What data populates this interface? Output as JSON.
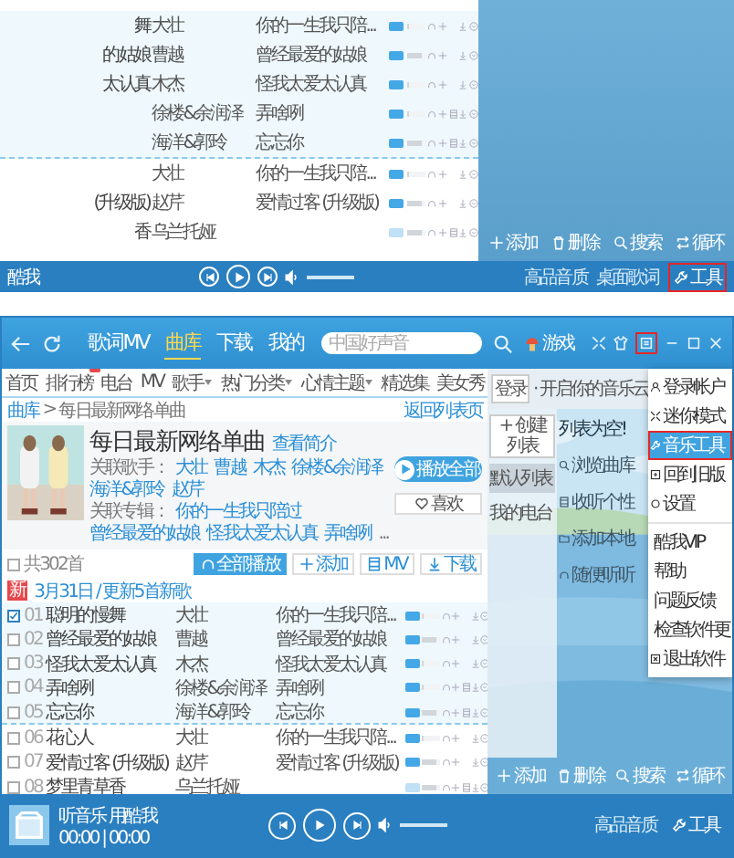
{
  "top_panel": {
    "rows": [
      {
        "title": "舞",
        "artist": "大壮",
        "album": "你的一生我只陪...",
        "hq": true,
        "level": 0.1,
        "mv": false,
        "new": true
      },
      {
        "title": "的姑娘",
        "artist": "曹越",
        "album": "曾经最爱的姑娘",
        "hq": true,
        "level": 0.8,
        "mv": false,
        "new": true
      },
      {
        "title": "太认真",
        "artist": "木杰",
        "album": "怪我太爱太认真",
        "hq": true,
        "level": 0.1,
        "mv": false,
        "new": true
      },
      {
        "artist": "徐楼&余润泽",
        "album": "弄啥咧",
        "hq": true,
        "level": 0.1,
        "mv": true,
        "new": true
      },
      {
        "artist": "海洋&郭玲",
        "album": "忘忘你",
        "hq": true,
        "level": 0.8,
        "mv": true,
        "new": true
      },
      {
        "artist": "大壮",
        "album": "你的一生我只陪...",
        "hq": true,
        "level": 0.1,
        "mv": false,
        "new": false
      },
      {
        "title": "(升级版)",
        "artist": "赵芹",
        "album": "爱情过客 (升级版)",
        "hq": true,
        "level": 0.8,
        "mv": false,
        "new": false
      },
      {
        "title": "香",
        "artist": "乌兰托娅",
        "hq": false,
        "level": 0.8,
        "mv": true,
        "new": false
      }
    ],
    "panel_actions": [
      {
        "kind": "plus",
        "label": "添加"
      },
      {
        "kind": "trash",
        "label": "删除"
      },
      {
        "kind": "search",
        "label": "搜索"
      },
      {
        "kind": "loop",
        "label": "循环"
      }
    ],
    "player": {
      "track": "酷我",
      "options": [
        "高品音质",
        "桌面歌词"
      ],
      "tools": {
        "label": "工具",
        "highlighted": true
      }
    }
  },
  "main_window": {
    "nav": {
      "tabs": [
        {
          "label": "歌词MV",
          "selected": false
        },
        {
          "label": "曲库",
          "selected": true
        },
        {
          "label": "下载",
          "selected": false
        },
        {
          "label": "我的",
          "selected": false
        }
      ],
      "search": {
        "placeholder": "中国好声音"
      },
      "game": "游戏",
      "menu_highlighted": true
    },
    "subnav": [
      {
        "label": "首页",
        "badge": false,
        "dropdown": false
      },
      {
        "label": "排行榜",
        "badge": true,
        "dropdown": false
      },
      {
        "label": "电台",
        "badge": false,
        "dropdown": false
      },
      {
        "label": "MV",
        "badge": false,
        "dropdown": false
      },
      {
        "label": "歌手",
        "badge": false,
        "dropdown": true
      },
      {
        "label": "热门分类",
        "badge": false,
        "dropdown": true
      },
      {
        "label": "心情主题",
        "badge": false,
        "dropdown": true
      },
      {
        "label": "精选集",
        "badge": false,
        "dropdown": false
      },
      {
        "label": "美女秀",
        "badge": false,
        "dropdown": false
      }
    ],
    "breadcrumb": {
      "root": "曲库",
      "separator": ">",
      "current": "每日最新网络单曲",
      "back": "返回列表页"
    },
    "album": {
      "title": "每日最新网络单曲",
      "intro": "查看简介",
      "artists_label": "关联歌手：",
      "artists": [
        "大壮",
        "曹越",
        "木杰",
        "徐楼&余润泽",
        "海洋&郭玲",
        "赵芹"
      ],
      "albums_label": "关联专辑：",
      "albums": [
        "你的一生我只陪过",
        "曾经最爱的姑娘",
        "怪我太爱太认真",
        "弄啥咧"
      ],
      "more": "...",
      "play_all": "播放全部",
      "like": "喜欢"
    },
    "toolbar": {
      "count": "共302首",
      "actions": [
        {
          "kind": "headphones",
          "label": "全部播放",
          "primary": true
        },
        {
          "kind": "plus",
          "label": "添加",
          "primary": false
        },
        {
          "kind": "film",
          "label": "MV",
          "primary": false
        },
        {
          "kind": "download",
          "label": "下载",
          "primary": false
        }
      ]
    },
    "section": {
      "badge": "新",
      "title": "3月31日 / 更新5首新歌"
    },
    "songs": [
      {
        "number": "01",
        "title": "聪明的慢舞",
        "artist": "大壮",
        "album": "你的一生我只陪...",
        "checked": true,
        "hq": true,
        "level": 0.1,
        "mv": false,
        "new": true
      },
      {
        "number": "02",
        "title": "曾经最爱的姑娘",
        "artist": "曹越",
        "album": "曾经最爱的姑娘",
        "checked": false,
        "hq": true,
        "level": 0.8,
        "mv": false,
        "new": true
      },
      {
        "number": "03",
        "title": "怪我太爱太认真",
        "artist": "木杰",
        "album": "怪我太爱太认真",
        "checked": false,
        "hq": true,
        "level": 0.1,
        "mv": false,
        "new": true
      },
      {
        "number": "04",
        "title": "弄啥咧",
        "artist": "徐楼&余润泽",
        "album": "弄啥咧",
        "checked": false,
        "hq": true,
        "level": 0.1,
        "mv": true,
        "new": true
      },
      {
        "number": "05",
        "title": "忘忘你",
        "artist": "海洋&郭玲",
        "album": "忘忘你",
        "checked": false,
        "hq": true,
        "level": 0.8,
        "mv": true,
        "new": true
      },
      {
        "number": "06",
        "title": "花心人",
        "artist": "大壮",
        "album": "你的一生我只陪...",
        "checked": false,
        "hq": true,
        "level": 0.1,
        "mv": false,
        "new": false
      },
      {
        "number": "07",
        "title": "爱情过客 (升级版)",
        "artist": "赵芹",
        "album": "爱情过客 (升级版)",
        "checked": false,
        "hq": true,
        "level": 0.8,
        "mv": false,
        "new": false
      },
      {
        "number": "08",
        "title": "梦里青草香",
        "artist": "乌兰托娅",
        "checked": false,
        "hq": false,
        "level": 0.8,
        "mv": true,
        "new": false
      }
    ],
    "side_panel": {
      "login": "登录",
      "hint": "· 开启你的音乐云",
      "create": "+ 创建列表",
      "lists": [
        {
          "label": "默认列表",
          "selected": true
        },
        {
          "label": "我的电台",
          "selected": false
        }
      ],
      "empty": "列表为空!",
      "tips": [
        {
          "kind": "search",
          "label": "浏览曲库"
        },
        {
          "kind": "film",
          "label": "收听个性"
        },
        {
          "kind": "folder",
          "label": "添加本地"
        },
        {
          "kind": "headphones",
          "label": "随便听听"
        }
      ],
      "actions": [
        {
          "kind": "plus",
          "label": "添加"
        },
        {
          "kind": "trash",
          "label": "删除"
        },
        {
          "kind": "search",
          "label": "搜索"
        },
        {
          "kind": "loop",
          "label": "循环"
        }
      ]
    },
    "menu": [
      {
        "kind": "user",
        "label": "登录帐户",
        "highlighted": false,
        "divider_before": false
      },
      {
        "kind": "mini",
        "label": "迷你模式",
        "highlighted": false,
        "divider_before": false
      },
      {
        "kind": "tools",
        "label": "音乐工具",
        "highlighted": true,
        "divider_before": false
      },
      {
        "kind": "old",
        "label": "回到旧版",
        "highlighted": false,
        "divider_before": false
      },
      {
        "kind": "settings",
        "label": "设置",
        "highlighted": false,
        "divider_before": false
      },
      {
        "kind": "plain",
        "label": "酷我VIP",
        "highlighted": false,
        "divider_before": true
      },
      {
        "kind": "plain",
        "label": "帮助",
        "highlighted": false,
        "divider_before": false
      },
      {
        "kind": "plain",
        "label": "问题反馈",
        "highlighted": false,
        "divider_before": false
      },
      {
        "kind": "plain",
        "label": "检查软件更",
        "highlighted": false,
        "divider_before": false
      },
      {
        "kind": "exit",
        "label": "退出软件",
        "highlighted": false,
        "divider_before": false
      }
    ],
    "player": {
      "track": "听音乐 用酷我",
      "time": "00:00 | 00:00",
      "quality": "高品音质",
      "tools": "工具"
    }
  }
}
